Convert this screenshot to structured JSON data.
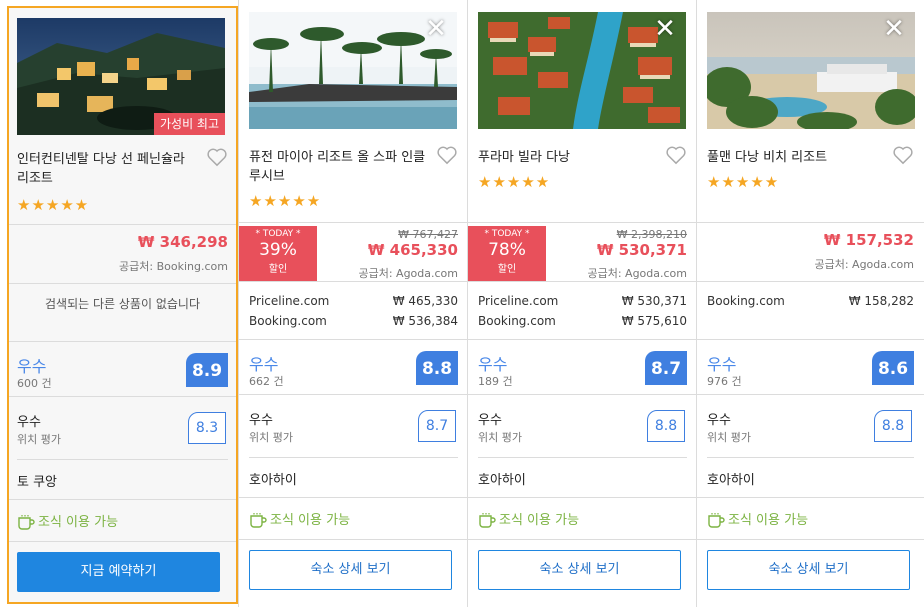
{
  "labels": {
    "close": "✕",
    "breakfast": "조식 이용 가능",
    "location_sub": "위치 평가"
  },
  "hotels": [
    {
      "name": "인터컨티넨탈 다낭 선 페닌슐라 리조트",
      "stars": "★★★★★",
      "badge": "가성비 최고",
      "price": "₩ 346,298",
      "supplier": "공급처: Booking.com",
      "no_more": "검색되는 다른 상품이 없습니다",
      "rating_word": "우수",
      "rating_count": "600 건",
      "rating_score": "8.9",
      "location_word": "우수",
      "location_score": "8.3",
      "area": "토 쿠앙",
      "button": "지금 예약하기"
    },
    {
      "name": "퓨전 마이아 리조트 올 스파 인클루시브",
      "stars": "★★★★★",
      "today_label": "* TODAY *",
      "discount": "39%",
      "discount_sub": "할인",
      "old_price": "₩ 767,427",
      "price": "₩ 465,330",
      "supplier": "공급처: Agoda.com",
      "offers": [
        {
          "provider": "Priceline.com",
          "price": "₩ 465,330"
        },
        {
          "provider": "Booking.com",
          "price": "₩ 536,384"
        }
      ],
      "rating_word": "우수",
      "rating_count": "662 건",
      "rating_score": "8.8",
      "location_word": "우수",
      "location_score": "8.7",
      "area": "호아하이",
      "button": "숙소 상세 보기"
    },
    {
      "name": "푸라마 빌라 다낭",
      "stars": "★★★★★",
      "today_label": "* TODAY *",
      "discount": "78%",
      "discount_sub": "할인",
      "old_price": "₩ 2,398,210",
      "price": "₩ 530,371",
      "supplier": "공급처: Agoda.com",
      "offers": [
        {
          "provider": "Priceline.com",
          "price": "₩ 530,371"
        },
        {
          "provider": "Booking.com",
          "price": "₩ 575,610"
        }
      ],
      "rating_word": "우수",
      "rating_count": "189 건",
      "rating_score": "8.7",
      "location_word": "우수",
      "location_score": "8.8",
      "area": "호아하이",
      "button": "숙소 상세 보기"
    },
    {
      "name": "풀맨 다낭 비치 리조트",
      "stars": "★★★★★",
      "price": "₩ 157,532",
      "supplier": "공급처: Agoda.com",
      "offers": [
        {
          "provider": "Booking.com",
          "price": "₩ 158,282"
        }
      ],
      "rating_word": "우수",
      "rating_count": "976 건",
      "rating_score": "8.6",
      "location_word": "우수",
      "location_score": "8.8",
      "area": "호아하이",
      "button": "숙소 상세 보기"
    }
  ],
  "colors": {
    "accent_blue": "#1f86e0",
    "price_red": "#e8505b",
    "star_orange": "#f5a623",
    "breakfast_green": "#7cb342"
  }
}
